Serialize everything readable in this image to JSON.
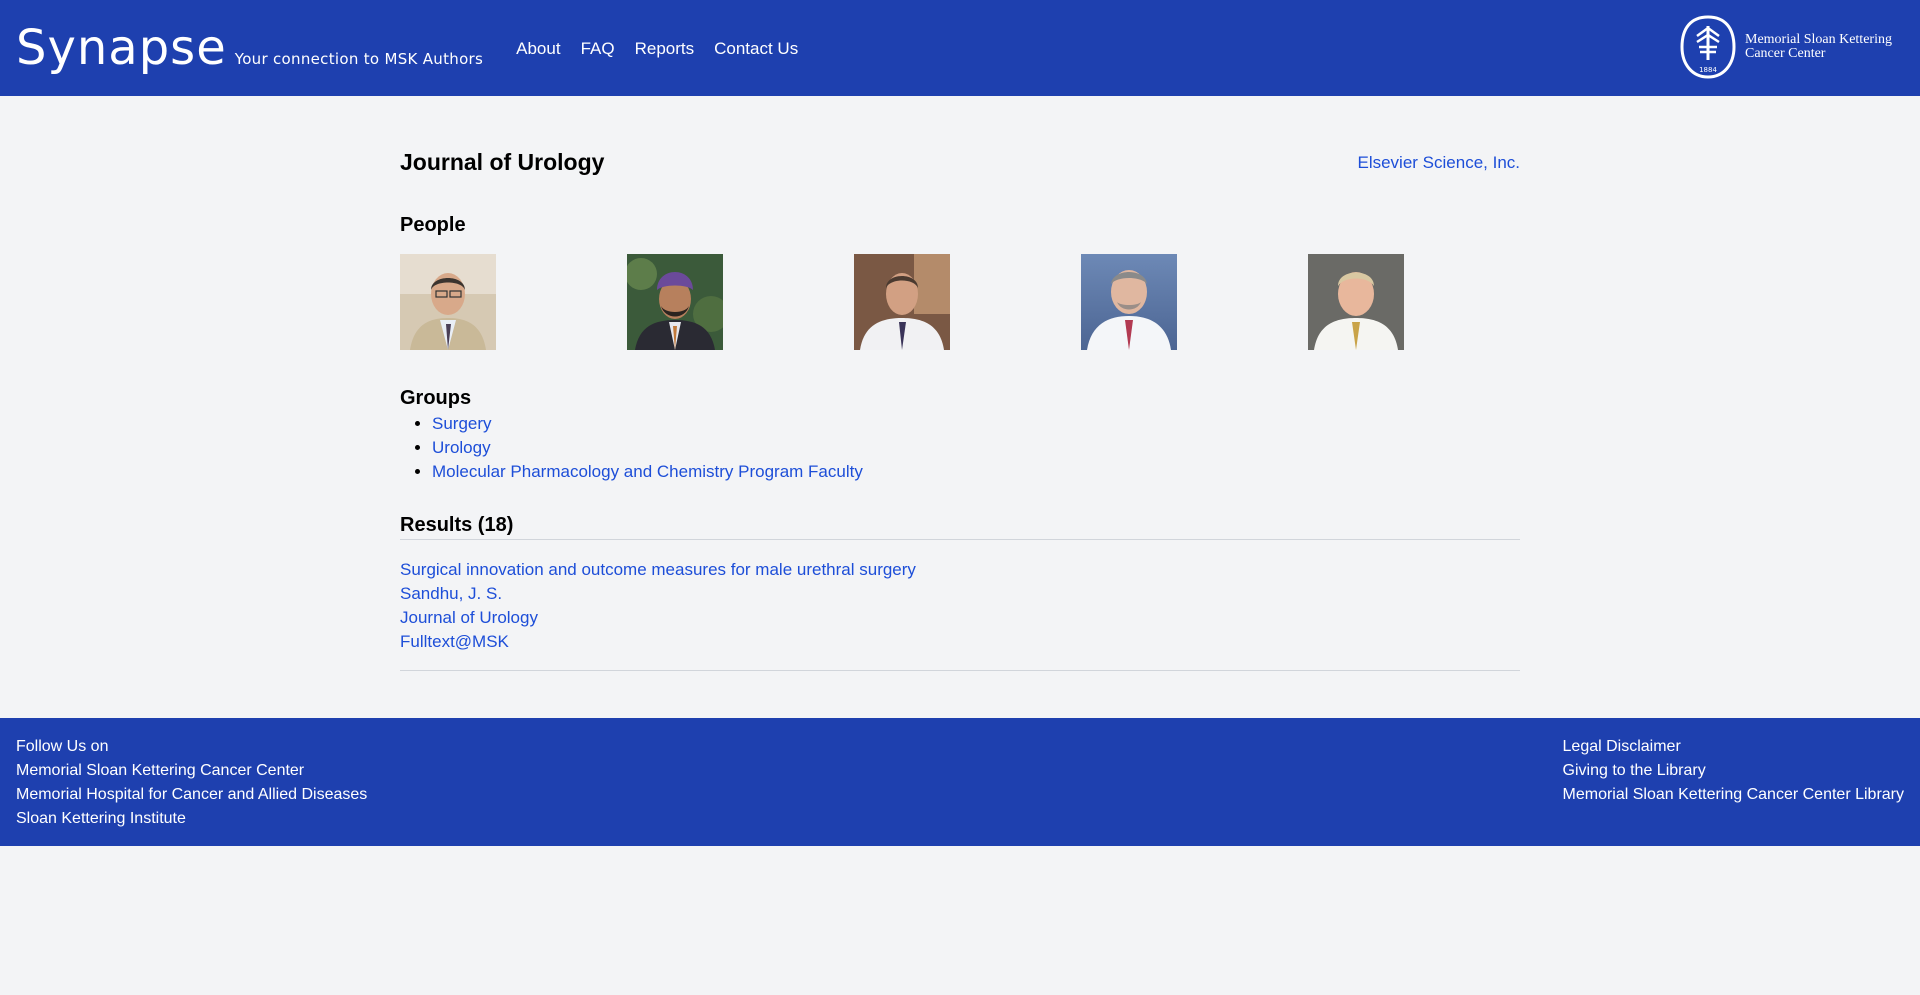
{
  "header": {
    "brand": "Synapse",
    "tagline": "Your connection to MSK Authors",
    "nav": [
      "About",
      "FAQ",
      "Reports",
      "Contact Us"
    ],
    "logo_text": "Memorial Sloan Kettering Cancer Center",
    "logo_year": "1884"
  },
  "journal": {
    "title": "Journal of Urology",
    "publisher": "Elsevier Science, Inc."
  },
  "people": {
    "heading": "People",
    "count": 5
  },
  "groups": {
    "heading": "Groups",
    "items": [
      "Surgery",
      "Urology",
      "Molecular Pharmacology and Chemistry Program Faculty"
    ]
  },
  "results": {
    "heading": "Results (18)",
    "items": [
      {
        "title": "Surgical innovation and outcome measures for male urethral surgery",
        "author": "Sandhu, J. S.",
        "journal": "Journal of Urology",
        "fulltext": "Fulltext@MSK"
      }
    ]
  },
  "footer": {
    "left": [
      "Follow Us on",
      "Memorial Sloan Kettering Cancer Center",
      "Memorial Hospital for Cancer and Allied Diseases",
      "Sloan Kettering Institute"
    ],
    "right": [
      "Legal Disclaimer",
      "Giving to the Library",
      "Memorial Sloan Kettering Cancer Center Library"
    ]
  },
  "colors": {
    "brand_blue": "#1e40af",
    "link_blue": "#1d4ed8",
    "page_bg": "#f3f4f6"
  }
}
